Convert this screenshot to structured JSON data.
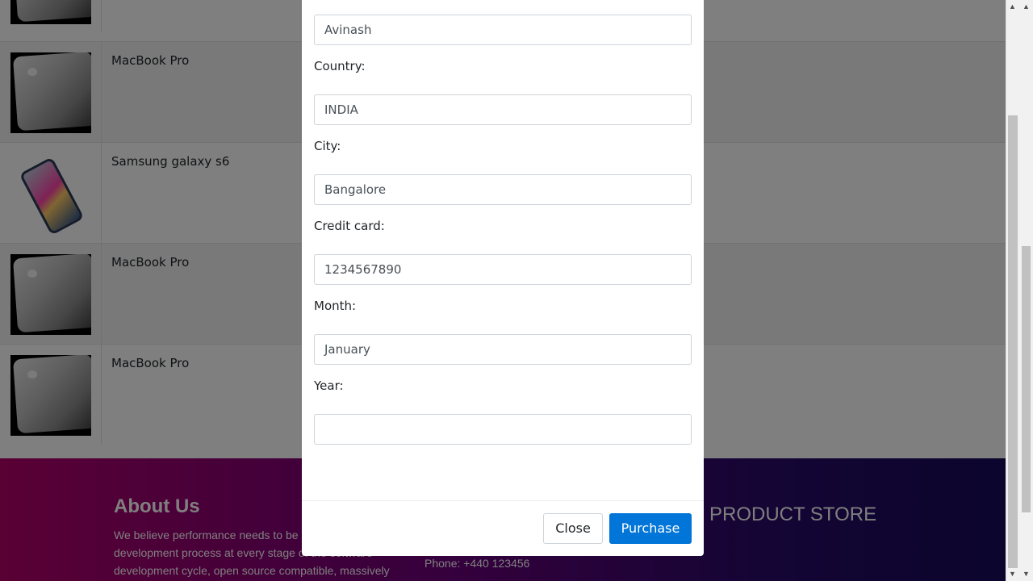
{
  "cart": {
    "rows": [
      {
        "title": "MacBook Pro",
        "image": "macbook-pro-image"
      },
      {
        "title": "Samsung galaxy s6",
        "image": "samsung-galaxy-s6-image"
      },
      {
        "title": "MacBook Pro",
        "image": "macbook-pro-image"
      },
      {
        "title": "MacBook Pro",
        "image": "macbook-pro-image"
      }
    ]
  },
  "modal": {
    "name_value": "Avinash",
    "country_label": "Country:",
    "country_value": "INDIA",
    "city_label": "City:",
    "city_value": "Bangalore",
    "card_label": "Credit card:",
    "card_value": "1234567890",
    "month_label": "Month:",
    "month_value": "January",
    "year_label": "Year:",
    "year_value": "",
    "close_label": "Close",
    "purchase_label": "Purchase"
  },
  "footer": {
    "about_title": "About Us",
    "about_text": "We believe performance needs to be part of the development process at every stage of the software development cycle, open source compatible, massively scalable platform makes",
    "phone": "Phone: +440 123456",
    "brand": "PRODUCT STORE"
  },
  "colors": {
    "primary": "#0275d8",
    "footer_start": "#b3006b",
    "footer_end": "#170a5a"
  }
}
